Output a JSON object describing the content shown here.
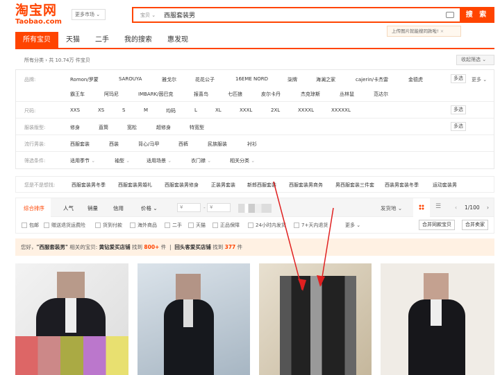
{
  "logo": {
    "cn": "淘宝网",
    "en": "Taobao.com"
  },
  "market_label": "更多市场",
  "search": {
    "type": "宝贝",
    "query": "西服套装男",
    "button": "搜 索",
    "tip": "上传图片就能搜同款啦!",
    "tip_close": "×"
  },
  "tabs": [
    "所有宝贝",
    "天猫",
    "二手",
    "我的搜索",
    "惠发现"
  ],
  "breadcrumb": "所有分类 › 共 10.74万 件宝贝",
  "recent_filter": "收起筛选 ⌄",
  "filters": {
    "brand": {
      "label": "品牌:",
      "row1": [
        "Romon/罗蒙",
        "SAROUYA",
        "雅戈尔",
        "花花公子",
        "16EME NORD",
        "柒牌",
        "海澜之家",
        "cajerin/卡杰雷",
        "金德虎"
      ],
      "row2": [
        "霸王车",
        "阿玛尼",
        "IMBARK/茵巴克",
        "报喜鸟",
        "七匹狼",
        "皮尔卡丹",
        "杰克琼斯",
        "丛林鼠",
        "范达尔"
      ],
      "multi": "多选",
      "more": "更多"
    },
    "size": {
      "label": "尺码:",
      "items": [
        "XXS",
        "XS",
        "S",
        "M",
        "均码",
        "L",
        "XL",
        "XXXL",
        "2XL",
        "XXXXL",
        "XXXXXL"
      ],
      "multi": "多选"
    },
    "fit": {
      "label": "服装版型:",
      "items": [
        "修身",
        "直筒",
        "宽松",
        "超修身",
        "特宽型"
      ],
      "multi": "多选"
    },
    "style": {
      "label": "流行男装:",
      "items": [
        "西服套装",
        "西装",
        "背心/马甲",
        "西裤",
        "民族服装",
        "衬衫"
      ]
    },
    "cond": {
      "label": "筛选条件:",
      "items": [
        "适用季节",
        "袖型",
        "适用场景",
        "衣门襟",
        "相关分类"
      ]
    }
  },
  "related": {
    "label": "您是不是想找:",
    "items": [
      "西服套装男冬季",
      "西服套装男婚礼",
      "西服套装男修身",
      "正装男套装",
      "新郎西服套装",
      "西服套装男商务",
      "男西服套装三件套",
      "西装男套装冬季",
      "运动套装男"
    ]
  },
  "sort": {
    "items": [
      "综合排序",
      "人气",
      "销量",
      "信用",
      "价格"
    ],
    "price_from": "¥",
    "price_to": "¥",
    "ship_from": "发货地",
    "page": "1/100"
  },
  "checks": [
    "包邮",
    "赠送退货运费险",
    "货到付款",
    "海外商品",
    "二手",
    "天猫",
    "正品保障",
    "24小时内发货",
    "7+天内退货"
  ],
  "more": "更多",
  "merge_shop": "合并同款宝贝",
  "merge_seller": "合并卖家",
  "notice": {
    "pre": "您好，",
    "kw": "\"西服套装男\"",
    "mid": " 相关的宝贝: ",
    "shop1": "黄钻爱买店铺",
    "found": " 找到 ",
    "n1": "800+",
    "unit": " 件 ",
    "sep": "|",
    "shop2": "回头客爱买店铺",
    "n2": "377"
  }
}
